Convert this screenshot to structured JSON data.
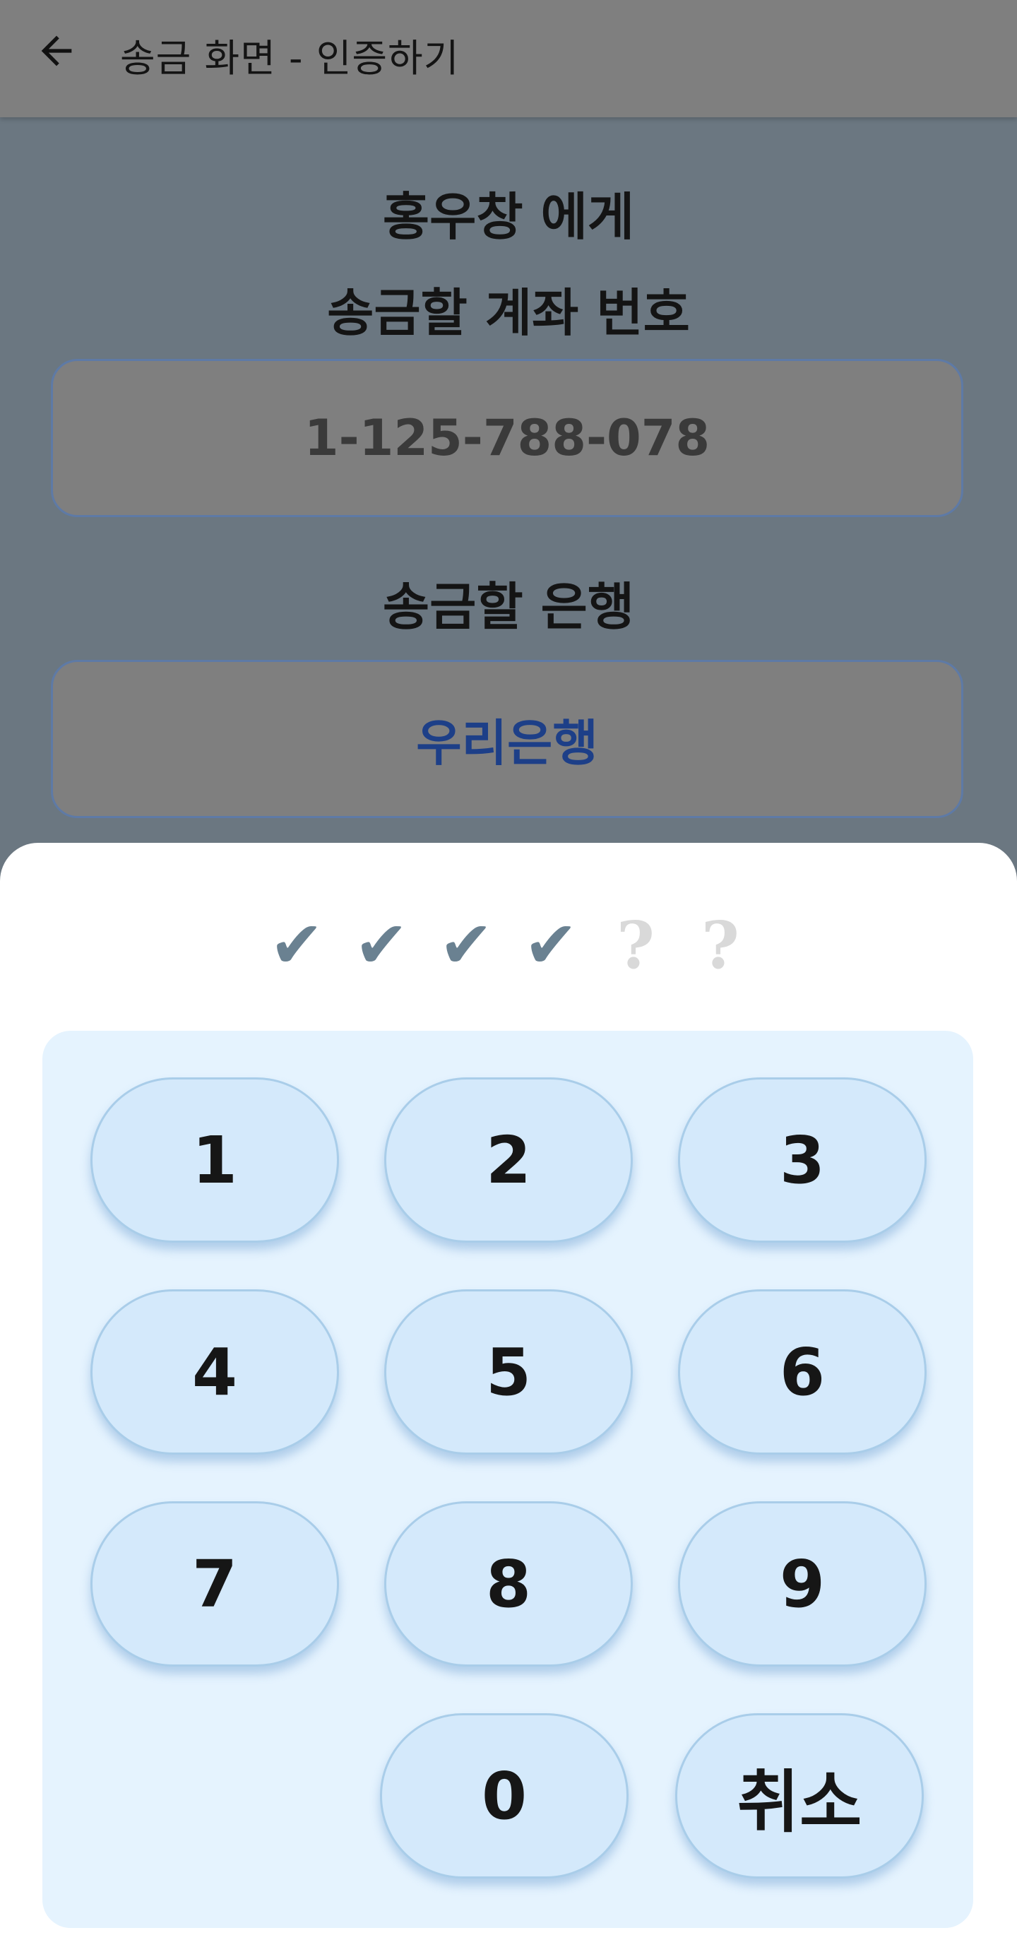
{
  "appbar": {
    "back_icon": "arrow-left-icon",
    "title": "송금 화면 - 인증하기"
  },
  "form": {
    "recipient_heading": "홍우창 에게",
    "account_label": "송금할 계좌 번호",
    "account_value": "1-125-788-078",
    "bank_label": "송금할 은행",
    "bank_value": "우리은행"
  },
  "pin": {
    "entered_symbol": "✔",
    "pending_symbol": "?",
    "digits_total": 6,
    "digits_entered": 4,
    "dots": [
      "✔",
      "✔",
      "✔",
      "✔",
      "?",
      "?"
    ]
  },
  "keypad": {
    "keys": [
      "1",
      "2",
      "3",
      "4",
      "5",
      "6",
      "7",
      "8",
      "9",
      "0"
    ],
    "cancel_label": "취소"
  },
  "colors": {
    "appbar_bg": "#7f7f7f",
    "overlay_bg": "#6b7781",
    "bank_text": "#1d3f88",
    "keypad_bg": "#e5f3fe",
    "key_bg": "#d4e9fb",
    "check_color": "#6a8191"
  }
}
